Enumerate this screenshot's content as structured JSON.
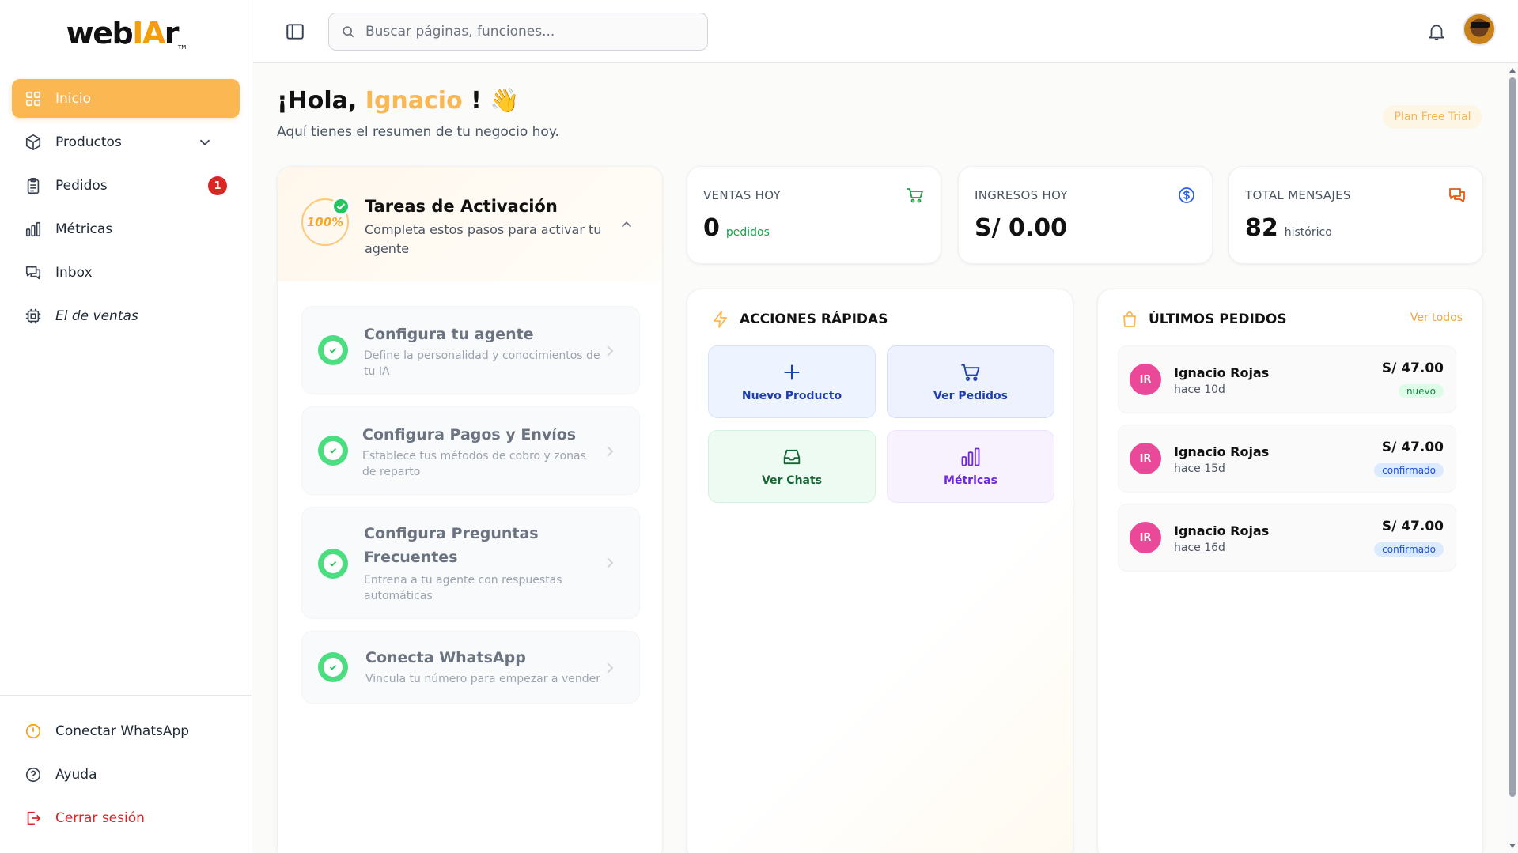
{
  "brand": {
    "logo_pre": "web",
    "logo_accent": "IA",
    "logo_post": "r",
    "logo_tm": "TM"
  },
  "sidebar": {
    "items": [
      {
        "label": "Inicio",
        "icon": "grid-icon"
      },
      {
        "label": "Productos",
        "icon": "box-icon"
      },
      {
        "label": "Pedidos",
        "icon": "clipboard-icon",
        "badge": "1"
      },
      {
        "label": "Métricas",
        "icon": "bar-chart-icon"
      },
      {
        "label": "Inbox",
        "icon": "chat-icon"
      },
      {
        "label": "El de ventas",
        "icon": "chip-icon"
      }
    ],
    "bottom": [
      {
        "label": "Conectar WhatsApp",
        "icon": "alert-icon"
      },
      {
        "label": "Ayuda",
        "icon": "help-icon"
      },
      {
        "label": "Cerrar sesión",
        "icon": "logout-icon"
      }
    ]
  },
  "search": {
    "placeholder": "Buscar páginas, funciones..."
  },
  "greeting": {
    "prefix": "¡Hola,",
    "name": "Ignacio",
    "suffix": "!",
    "emoji": "👋",
    "subtitle": "Aquí tienes el resumen de tu negocio hoy."
  },
  "plan": "Plan Free Trial",
  "activation": {
    "percent": "100%",
    "title": "Tareas de Activación",
    "subtitle": "Completa estos pasos para activar tu agente",
    "tasks": [
      {
        "title": "Configura tu agente",
        "desc": "Define la personalidad y conocimientos de tu IA"
      },
      {
        "title": "Configura Pagos y Envíos",
        "desc": "Establece tus métodos de cobro y zonas de reparto"
      },
      {
        "title": "Configura Preguntas Frecuentes",
        "desc": "Entrena a tu agente con respuestas automáticas"
      },
      {
        "title": "Conecta WhatsApp",
        "desc": "Vincula tu número para empezar a vender"
      }
    ]
  },
  "stats": [
    {
      "label": "VENTAS HOY",
      "value": "0",
      "unit": "pedidos",
      "color": "#16a34a"
    },
    {
      "label": "INGRESOS HOY",
      "value": "S/ 0.00",
      "unit": "",
      "color": "#2563eb"
    },
    {
      "label": "TOTAL MENSAJES",
      "value": "82",
      "unit": "histórico",
      "color": "#ea580c"
    }
  ],
  "quick_actions": {
    "title": "ACCIONES RÁPIDAS",
    "items": [
      {
        "label": "Nuevo Producto",
        "icon": "plus-icon",
        "color": "#1e40af",
        "bg": "#eef4ff"
      },
      {
        "label": "Ver Pedidos",
        "icon": "cart-icon",
        "color": "#1e40af",
        "bg": "#eef2fe"
      },
      {
        "label": "Ver Chats",
        "icon": "inbox-icon",
        "color": "#166534",
        "bg": "#edfbf2"
      },
      {
        "label": "Métricas",
        "icon": "bar-chart-icon",
        "color": "#6d28d9",
        "bg": "#f8f2ff"
      }
    ]
  },
  "orders": {
    "title": "ÚLTIMOS PEDIDOS",
    "see_all": "Ver todos",
    "items": [
      {
        "initials": "IR",
        "name": "Ignacio Rojas",
        "time": "hace 10d",
        "amount": "S/ 47.00",
        "status": "nuevo",
        "status_color": "#15803d",
        "status_bg": "#dcfce7"
      },
      {
        "initials": "IR",
        "name": "Ignacio Rojas",
        "time": "hace 15d",
        "amount": "S/ 47.00",
        "status": "confirmado",
        "status_color": "#1d4ed8",
        "status_bg": "#dbeafe"
      },
      {
        "initials": "IR",
        "name": "Ignacio Rojas",
        "time": "hace 16d",
        "amount": "S/ 47.00",
        "status": "confirmado",
        "status_color": "#1d4ed8",
        "status_bg": "#dbeafe"
      }
    ]
  },
  "colors": {
    "accent": "#fbb751",
    "danger": "#dc2626",
    "success": "#22c55e"
  }
}
